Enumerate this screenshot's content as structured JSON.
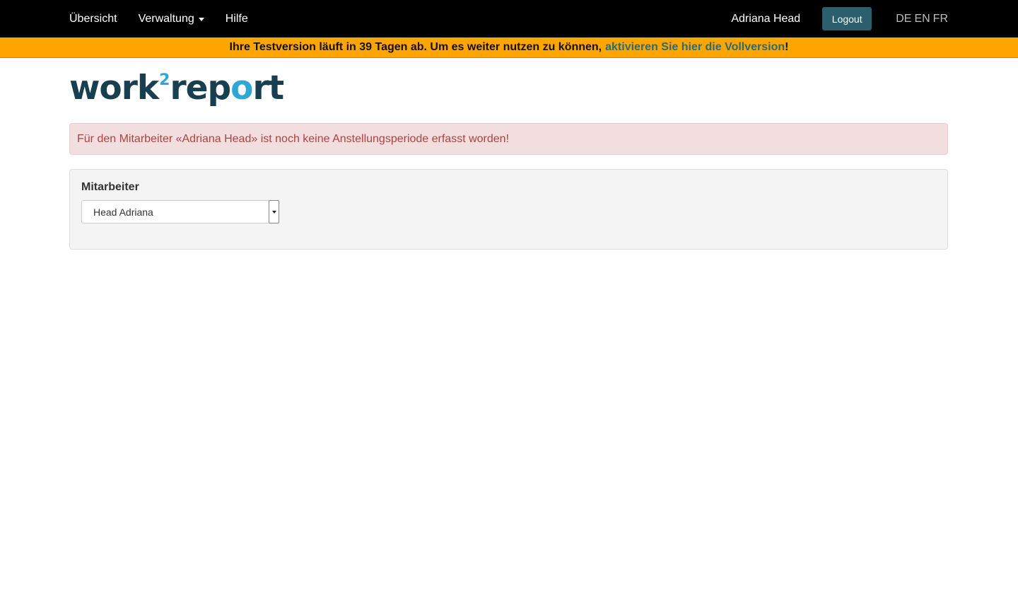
{
  "nav": {
    "items": [
      {
        "label": "Übersicht"
      },
      {
        "label": "Verwaltung"
      },
      {
        "label": "Hilfe"
      }
    ],
    "username": "Adriana Head",
    "logout_label": "Logout",
    "languages": [
      "DE",
      "EN",
      "FR"
    ]
  },
  "trial_banner": {
    "text": "Ihre Testversion läuft in 39 Tagen ab. Um es weiter nutzen zu können,",
    "link_text": "aktivieren Sie hier die Vollversion",
    "suffix": "!"
  },
  "logo": {
    "part1": "work",
    "sup": "2",
    "part2": "rep",
    "o": "o",
    "part3": "rt"
  },
  "alert": {
    "message": "Für den Mitarbeiter «Adriana Head» ist noch keine Anstellungsperiode erfasst worden!"
  },
  "panel": {
    "label": "Mitarbeiter",
    "select_value": "Head Adriana"
  },
  "colors": {
    "nav_bg": "#000000",
    "banner_bg": "#ffa500",
    "accent": "#2b5f6e",
    "alert_bg": "#f2dede",
    "alert_text": "#a94442"
  }
}
